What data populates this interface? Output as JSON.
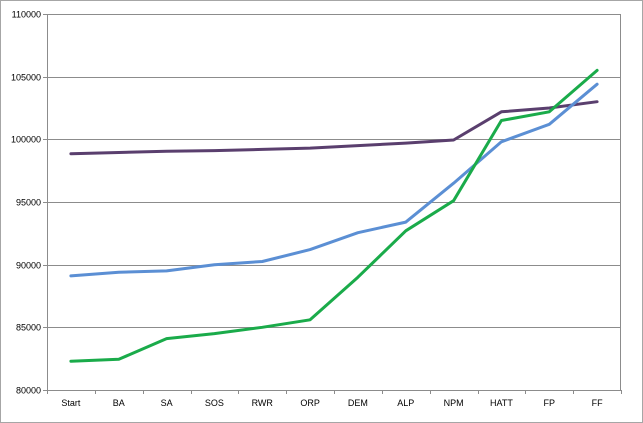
{
  "chart_data": {
    "type": "line",
    "title": "",
    "xlabel": "",
    "ylabel": "",
    "categories": [
      "Start",
      "BA",
      "SA",
      "SOS",
      "RWR",
      "ORP",
      "DEM",
      "ALP",
      "NPM",
      "HATT",
      "FP",
      "FF"
    ],
    "ylim": [
      80000,
      110000
    ],
    "yticks": [
      80000,
      85000,
      90000,
      95000,
      100000,
      105000,
      110000
    ],
    "grid": true,
    "legend": "none",
    "series": [
      {
        "color": "#5a3f6e",
        "values": [
          98850,
          98950,
          99050,
          99100,
          99200,
          99300,
          99500,
          99700,
          99950,
          102200,
          102500,
          103000
        ]
      },
      {
        "color": "#5b8fd4",
        "values": [
          89100,
          89400,
          89500,
          90000,
          90250,
          91200,
          92550,
          93400,
          96500,
          99800,
          101200,
          104400
        ]
      },
      {
        "color": "#1aab4a",
        "values": [
          82300,
          82450,
          84100,
          84500,
          85000,
          85600,
          89000,
          92700,
          95100,
          101500,
          102200,
          105500
        ]
      }
    ]
  }
}
